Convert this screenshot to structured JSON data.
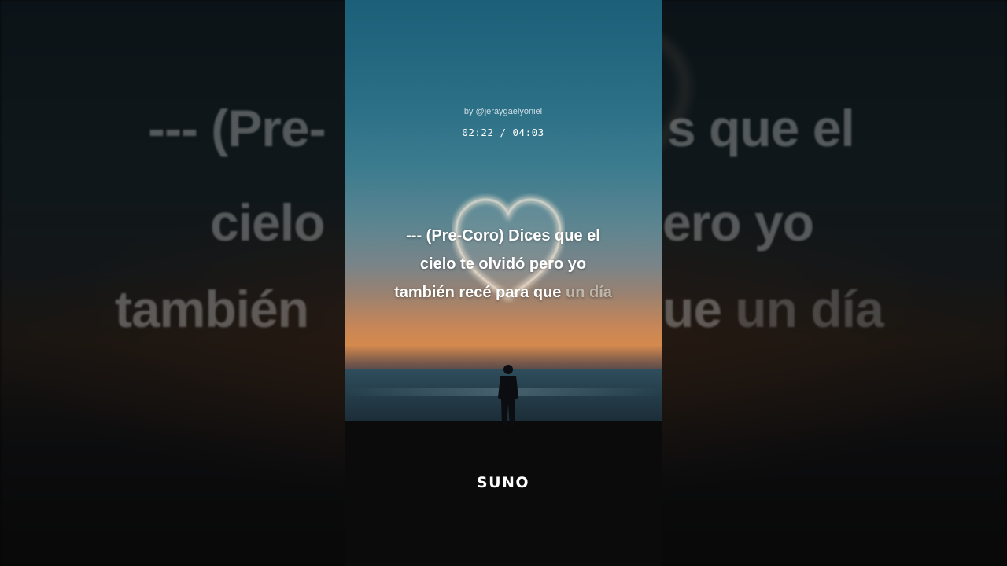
{
  "overlay": {
    "credit": "by @jeraygaelyoniel",
    "time_current": "02:22",
    "time_separator": " / ",
    "time_total": "04:03"
  },
  "lyrics": {
    "line1": "--- (Pre-Coro) Dices que el",
    "line2": "cielo te olvidó pero yo",
    "line3_sung": "también recé para que ",
    "line3_upcoming": "un día"
  },
  "background_lyrics": {
    "line1_left": "--- (Pre-",
    "line1_right": "s que el",
    "line2_left": "cielo",
    "line2_right": "ero yo",
    "line3_left": "también",
    "line3_right": "ue ",
    "line3_right_dim": "un día"
  },
  "brand": {
    "logo": "SUNO"
  },
  "icons": {
    "heart": "heart-icon",
    "figure": "person-silhouette"
  },
  "colors": {
    "sky_top": "#1b5f78",
    "sunset": "#d58a4d",
    "lyric_active": "#ffffff",
    "lyric_upcoming": "#dcd7cd"
  }
}
